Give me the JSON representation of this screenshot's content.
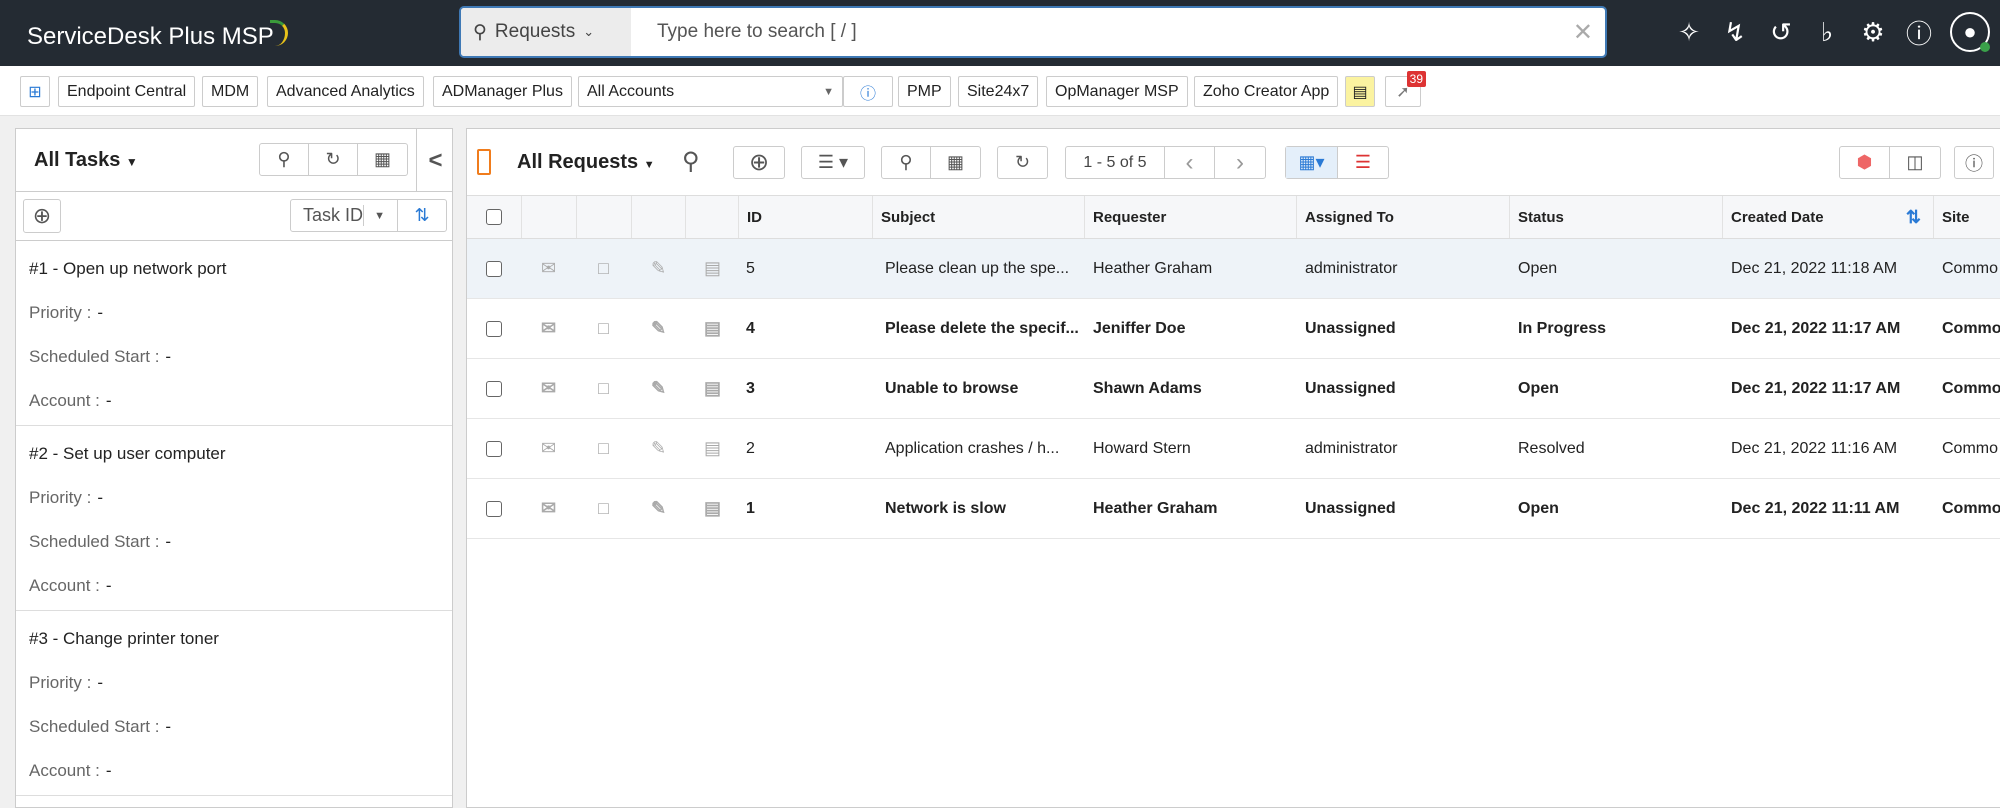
{
  "app": {
    "title": "ServiceDesk Plus MSP"
  },
  "search": {
    "module": "Requests",
    "placeholder": "Type here to search [ / ]"
  },
  "topicons": [
    "tools-icon",
    "lightning-icon",
    "history-icon",
    "bell-icon",
    "gear-icon",
    "help-icon",
    "avatar-icon"
  ],
  "toolbar": {
    "items": [
      "Endpoint Central",
      "MDM",
      "Advanced Analytics",
      "ADManager Plus"
    ],
    "account": "All Accounts",
    "items2": [
      "PMP",
      "Site24x7",
      "OpManager MSP",
      "Zoho Creator App"
    ],
    "notif_count": "39"
  },
  "tasks": {
    "title": "All Tasks",
    "sort": "Task ID",
    "items": [
      {
        "title": "#1 - Open up network port",
        "priority_label": "Priority :",
        "priority": "-",
        "start_label": "Scheduled Start :",
        "start": "-",
        "account_label": "Account :",
        "account": "-"
      },
      {
        "title": "#2 - Set up user computer",
        "priority_label": "Priority :",
        "priority": "-",
        "start_label": "Scheduled Start :",
        "start": "-",
        "account_label": "Account :",
        "account": "-"
      },
      {
        "title": "#3 - Change printer toner",
        "priority_label": "Priority :",
        "priority": "-",
        "start_label": "Scheduled Start :",
        "start": "-",
        "account_label": "Account :",
        "account": "-"
      }
    ]
  },
  "requests": {
    "view": "All Requests",
    "pagination": "1 - 5 of 5",
    "columns": [
      "ID",
      "Subject",
      "Requester",
      "Assigned To",
      "Status",
      "Created Date",
      "Site"
    ],
    "rows": [
      {
        "id": "5",
        "subject": "Please clean up the spe...",
        "requester": "Heather Graham",
        "assigned": "administrator",
        "status": "Open",
        "created": "Dec 21, 2022 11:18 AM",
        "site": "Commo"
      },
      {
        "id": "4",
        "subject": "Please delete the specif...",
        "requester": "Jeniffer Doe",
        "assigned": "Unassigned",
        "status": "In Progress",
        "created": "Dec 21, 2022 11:17 AM",
        "site": "Commo"
      },
      {
        "id": "3",
        "subject": "Unable to browse",
        "requester": "Shawn Adams",
        "assigned": "Unassigned",
        "status": "Open",
        "created": "Dec 21, 2022 11:17 AM",
        "site": "Commo"
      },
      {
        "id": "2",
        "subject": "Application crashes / h...",
        "requester": "Howard Stern",
        "assigned": "administrator",
        "status": "Resolved",
        "created": "Dec 21, 2022 11:16 AM",
        "site": "Commo"
      },
      {
        "id": "1",
        "subject": "Network is slow",
        "requester": "Heather Graham",
        "assigned": "Unassigned",
        "status": "Open",
        "created": "Dec 21, 2022 11:11 AM",
        "site": "Commo"
      }
    ]
  }
}
